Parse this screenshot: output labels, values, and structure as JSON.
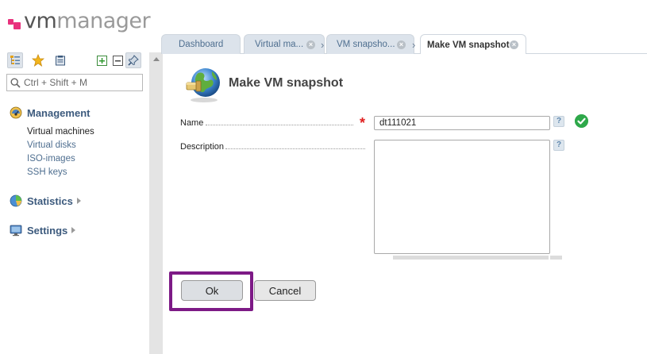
{
  "app": {
    "logo_vm": "vm",
    "logo_manager": "manager"
  },
  "sidebar": {
    "search_placeholder": "Ctrl + Shift + M",
    "sections": [
      {
        "label": "Management",
        "items": [
          "Virtual machines",
          "Virtual disks",
          "ISO-images",
          "SSH keys"
        ],
        "current": "Virtual machines"
      },
      {
        "label": "Statistics"
      },
      {
        "label": "Settings"
      }
    ]
  },
  "tabs": [
    {
      "label": "Dashboard"
    },
    {
      "label": "Virtual ma..."
    },
    {
      "label": "VM snapsho..."
    },
    {
      "label": "Make VM snapshot",
      "active": true
    }
  ],
  "form": {
    "title": "Make VM snapshot",
    "name_label": "Name",
    "name_value": "dt111021",
    "required_mark": "*",
    "description_label": "Description",
    "description_value": "",
    "help_mark": "?"
  },
  "buttons": {
    "ok": "Ok",
    "cancel": "Cancel"
  },
  "colors": {
    "accent": "#3c5a7d",
    "highlight": "#7d1a86",
    "required": "#e02020",
    "valid": "#2ea84a",
    "brand": "#e8317d"
  }
}
